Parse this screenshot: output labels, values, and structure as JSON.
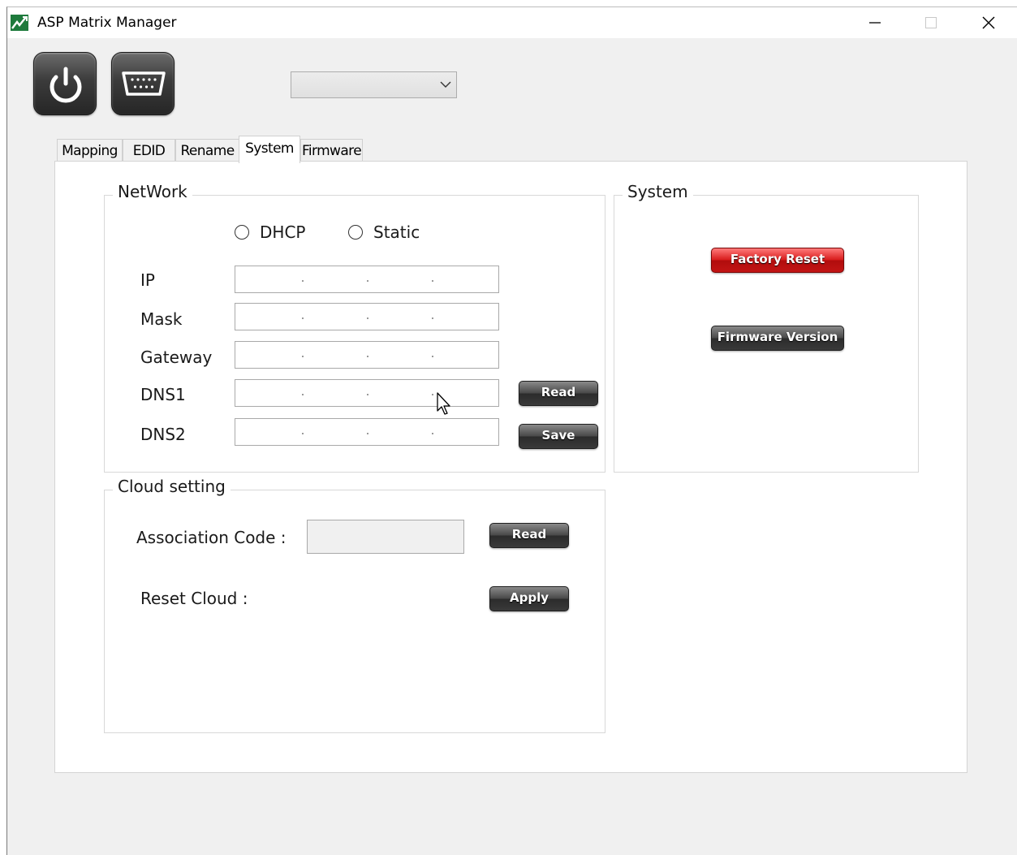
{
  "window": {
    "title": "ASP Matrix Manager"
  },
  "toolbar": {
    "device_combo_value": ""
  },
  "tabs": [
    {
      "label": "Mapping"
    },
    {
      "label": "EDID"
    },
    {
      "label": "Rename"
    },
    {
      "label": "System"
    },
    {
      "label": "Firmware"
    }
  ],
  "active_tab": "System",
  "network": {
    "title": "NetWork",
    "radio_dhcp": "DHCP",
    "radio_static": "Static",
    "fields": {
      "ip": "IP",
      "mask": "Mask",
      "gateway": "Gateway",
      "dns1": "DNS1",
      "dns2": "DNS2"
    },
    "read_label": "Read",
    "save_label": "Save"
  },
  "system": {
    "title": "System",
    "factory_reset_label": "Factory Reset",
    "firmware_version_label": "Firmware Version"
  },
  "cloud": {
    "title": "Cloud setting",
    "association_code_label": "Association Code :",
    "association_code_value": "",
    "reset_cloud_label": "Reset Cloud :",
    "read_label": "Read",
    "apply_label": "Apply"
  },
  "colors": {
    "danger": "#d81c1c",
    "button_dark": "#3a3a3a",
    "brand_green": "#1e7a3c"
  },
  "icons": [
    "app-logo-icon",
    "minimize-icon",
    "maximize-icon",
    "close-icon",
    "power-icon",
    "serial-port-icon",
    "chevron-down-icon",
    "cursor-icon"
  ]
}
